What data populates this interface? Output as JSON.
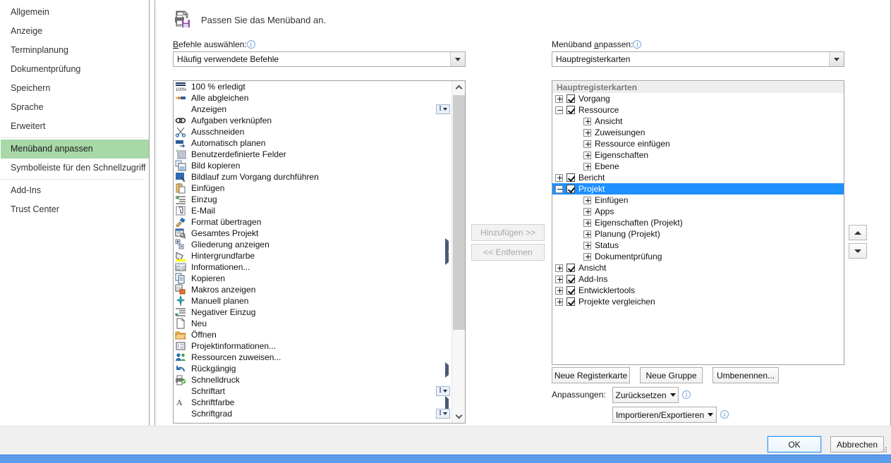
{
  "sidebar": {
    "items": [
      {
        "label": "Allgemein",
        "selected": false,
        "sep_after": false
      },
      {
        "label": "Anzeige",
        "selected": false,
        "sep_after": false
      },
      {
        "label": "Terminplanung",
        "selected": false,
        "sep_after": false
      },
      {
        "label": "Dokumentprüfung",
        "selected": false,
        "sep_after": false
      },
      {
        "label": "Speichern",
        "selected": false,
        "sep_after": false
      },
      {
        "label": "Sprache",
        "selected": false,
        "sep_after": false
      },
      {
        "label": "Erweitert",
        "selected": false,
        "sep_after": true
      },
      {
        "label": "Menüband anpassen",
        "selected": true,
        "sep_after": false
      },
      {
        "label": "Symbolleiste für den Schnellzugriff",
        "selected": false,
        "sep_after": true
      },
      {
        "label": "Add-Ins",
        "selected": false,
        "sep_after": false
      },
      {
        "label": "Trust Center",
        "selected": false,
        "sep_after": false
      }
    ]
  },
  "header": {
    "title": "Passen Sie das Menüband an.",
    "icon": "printer-save-icon"
  },
  "left_panel": {
    "label_prefix": "B",
    "label_rest": "efehle auswählen:",
    "info_icon": "info-icon",
    "combo_value": "Häufig verwendete Befehle",
    "commands": [
      {
        "label": "100 % erledigt",
        "icon": "percent-complete-icon",
        "sub": "none"
      },
      {
        "label": "Alle abgleichen",
        "icon": "sync-all-icon",
        "sub": "none"
      },
      {
        "label": "Anzeigen",
        "icon": "none",
        "sub": "split"
      },
      {
        "label": "Aufgaben verknüpfen",
        "icon": "link-tasks-icon",
        "sub": "none"
      },
      {
        "label": "Ausschneiden",
        "icon": "scissors-icon",
        "sub": "none"
      },
      {
        "label": "Automatisch planen",
        "icon": "auto-schedule-icon",
        "sub": "none"
      },
      {
        "label": "Benutzerdefinierte Felder",
        "icon": "custom-fields-icon",
        "sub": "none"
      },
      {
        "label": "Bild kopieren",
        "icon": "copy-picture-icon",
        "sub": "none"
      },
      {
        "label": "Bildlauf zum Vorgang durchführen",
        "icon": "scroll-to-task-icon",
        "sub": "none"
      },
      {
        "label": "Einfügen",
        "icon": "paste-icon",
        "sub": "none"
      },
      {
        "label": "Einzug",
        "icon": "indent-icon",
        "sub": "none"
      },
      {
        "label": "E-Mail",
        "icon": "email-icon",
        "sub": "none"
      },
      {
        "label": "Format übertragen",
        "icon": "format-painter-icon",
        "sub": "none"
      },
      {
        "label": "Gesamtes Projekt",
        "icon": "entire-project-icon",
        "sub": "none"
      },
      {
        "label": "Gliederung anzeigen",
        "icon": "outline-icon",
        "sub": "arrow"
      },
      {
        "label": "Hintergrundfarbe",
        "icon": "fill-color-icon",
        "sub": "arrow"
      },
      {
        "label": "Informationen...",
        "icon": "information-icon",
        "sub": "none"
      },
      {
        "label": "Kopieren",
        "icon": "copy-icon",
        "sub": "none"
      },
      {
        "label": "Makros anzeigen",
        "icon": "macros-icon",
        "sub": "none"
      },
      {
        "label": "Manuell planen",
        "icon": "manual-schedule-icon",
        "sub": "none"
      },
      {
        "label": "Negativer Einzug",
        "icon": "outdent-icon",
        "sub": "none"
      },
      {
        "label": "Neu",
        "icon": "new-document-icon",
        "sub": "none"
      },
      {
        "label": "Öffnen",
        "icon": "open-folder-icon",
        "sub": "none"
      },
      {
        "label": "Projektinformationen...",
        "icon": "project-information-icon",
        "sub": "none"
      },
      {
        "label": "Ressourcen zuweisen...",
        "icon": "assign-resources-icon",
        "sub": "none"
      },
      {
        "label": "Rückgängig",
        "icon": "undo-icon",
        "sub": "arrow"
      },
      {
        "label": "Schnelldruck",
        "icon": "quick-print-icon",
        "sub": "none"
      },
      {
        "label": "Schriftart",
        "icon": "none",
        "sub": "split"
      },
      {
        "label": "Schriftfarbe",
        "icon": "font-color-icon",
        "sub": "arrow"
      },
      {
        "label": "Schriftgrad",
        "icon": "none",
        "sub": "split"
      }
    ]
  },
  "middle": {
    "add_label": "Hinzufügen >>",
    "remove_label": "<< Entfernen"
  },
  "right_panel": {
    "label_prefix": "Menüband ",
    "label_underlined": "a",
    "label_rest": "npassen:",
    "info_icon": "info-icon",
    "combo_value": "Hauptregisterkarten",
    "tree_header": "Hauptregisterkarten",
    "tree": [
      {
        "label": "Vorgang",
        "level": 1,
        "expander": "plus",
        "checkbox": "checked",
        "selected": false
      },
      {
        "label": "Ressource",
        "level": 1,
        "expander": "minus",
        "checkbox": "checked",
        "selected": false
      },
      {
        "label": "Ansicht",
        "level": 2,
        "expander": "plus",
        "checkbox": "none",
        "selected": false
      },
      {
        "label": "Zuweisungen",
        "level": 2,
        "expander": "plus",
        "checkbox": "none",
        "selected": false
      },
      {
        "label": "Ressource einfügen",
        "level": 2,
        "expander": "plus",
        "checkbox": "none",
        "selected": false
      },
      {
        "label": "Eigenschaften",
        "level": 2,
        "expander": "plus",
        "checkbox": "none",
        "selected": false
      },
      {
        "label": "Ebene",
        "level": 2,
        "expander": "plus",
        "checkbox": "none",
        "selected": false
      },
      {
        "label": "Bericht",
        "level": 1,
        "expander": "plus",
        "checkbox": "checked",
        "selected": false
      },
      {
        "label": "Projekt",
        "level": 1,
        "expander": "minus",
        "checkbox": "checked",
        "selected": true
      },
      {
        "label": "Einfügen",
        "level": 2,
        "expander": "plus",
        "checkbox": "none",
        "selected": false
      },
      {
        "label": "Apps",
        "level": 2,
        "expander": "plus",
        "checkbox": "none",
        "selected": false
      },
      {
        "label": "Eigenschaften (Projekt)",
        "level": 2,
        "expander": "plus",
        "checkbox": "none",
        "selected": false
      },
      {
        "label": "Planung (Projekt)",
        "level": 2,
        "expander": "plus",
        "checkbox": "none",
        "selected": false
      },
      {
        "label": "Status",
        "level": 2,
        "expander": "plus",
        "checkbox": "none",
        "selected": false
      },
      {
        "label": "Dokumentprüfung",
        "level": 2,
        "expander": "plus",
        "checkbox": "none",
        "selected": false
      },
      {
        "label": "Ansicht",
        "level": 1,
        "expander": "plus",
        "checkbox": "checked",
        "selected": false
      },
      {
        "label": "Add-Ins",
        "level": 1,
        "expander": "plus",
        "checkbox": "checked",
        "selected": false
      },
      {
        "label": "Entwicklertools",
        "level": 1,
        "expander": "plus",
        "checkbox": "checked",
        "selected": false
      },
      {
        "label": "Projekte vergleichen",
        "level": 1,
        "expander": "plus",
        "checkbox": "checked",
        "selected": false
      }
    ],
    "buttons": {
      "new_tab": "Neue Registerkarte",
      "new_group": "Neue Gruppe",
      "rename": "Umbenennen..."
    },
    "customizations_label": "Anpassungen:",
    "reset_label": "Zurücksetzen",
    "import_export_label": "Importieren/Exportieren"
  },
  "reorder": {
    "up_icon": "arrow-up-icon",
    "down_icon": "arrow-down-icon"
  },
  "footer": {
    "ok": "OK",
    "cancel": "Abbrechen"
  },
  "colors": {
    "selection_blue": "#1e90ff",
    "nav_selected_green": "#a8d8a8",
    "taskbar_blue": "#5b9bec",
    "accent_purple": "#8a54a8"
  }
}
